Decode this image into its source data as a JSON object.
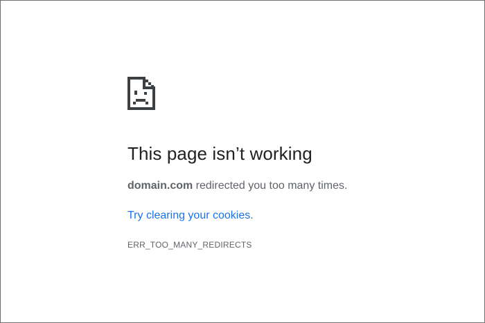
{
  "error_page": {
    "icon": "sad-page-icon",
    "title": "This page isn’t working",
    "detail_domain": "domain.com",
    "detail_text": " redirected you too many times.",
    "suggestion_link": "Try clearing your cookies",
    "suggestion_suffix": ".",
    "error_code": "ERR_TOO_MANY_REDIRECTS"
  },
  "colors": {
    "title": "#202124",
    "body_text": "#5f6368",
    "link": "#1a73e8",
    "icon": "#3c4043"
  }
}
